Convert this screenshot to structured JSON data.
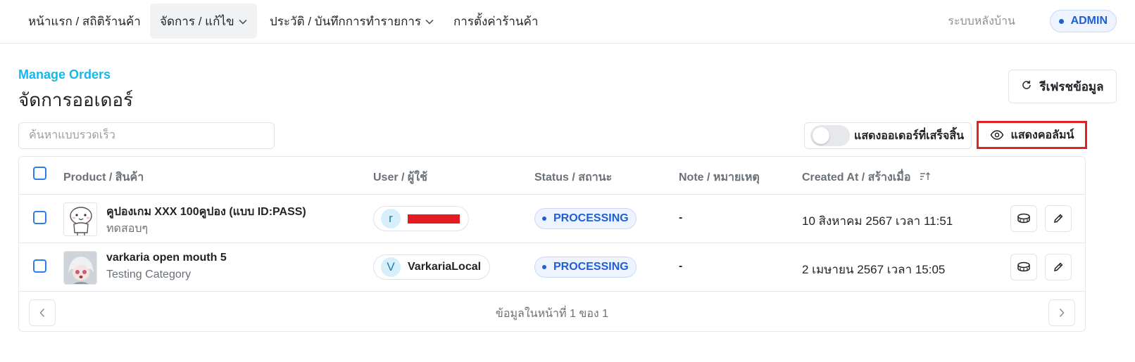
{
  "nav": {
    "items": [
      {
        "label": "หน้าแรก / สถิติร้านค้า"
      },
      {
        "label": "จัดการ / แก้ไข"
      },
      {
        "label": "ประวัติ / บันทึกการทำรายการ"
      },
      {
        "label": "การตั้งค่าร้านค้า"
      }
    ],
    "backoffice_label": "ระบบหลังบ้าน",
    "role_badge": "ADMIN"
  },
  "header": {
    "eyebrow": "Manage Orders",
    "title": "จัดการออเดอร์",
    "refresh_label": "รีเฟรชข้อมูล"
  },
  "toolbar": {
    "search_placeholder": "ค้นหาแบบรวดเร็ว",
    "toggle_label": "แสดงออเดอร์ที่เสร็จสิ้น",
    "toggle_on": false,
    "columns_label": "แสดงคอลัมน์"
  },
  "table": {
    "headers": {
      "product": "Product / สินค้า",
      "user": "User / ผู้ใช้",
      "status": "Status / สถานะ",
      "note": "Note / หมายเหตุ",
      "created": "Created At / สร้างเมื่อ"
    },
    "rows": [
      {
        "product_name": "คูปองเกม XXX 100คูปอง (แบบ ID:PASS)",
        "product_category": "ทดสอบๆ",
        "user_initial": "r",
        "user_name": "",
        "status": "PROCESSING",
        "note": "-",
        "created_at": "10 สิงหาคม 2567 เวลา 11:51"
      },
      {
        "product_name": "varkaria open mouth 5",
        "product_category": "Testing Category",
        "user_initial": "V",
        "user_name": "VarkariaLocal",
        "status": "PROCESSING",
        "note": "-",
        "created_at": "2 เมษายน 2567 เวลา 15:05"
      }
    ]
  },
  "pagination": {
    "text": "ข้อมูลในหน้าที่ 1 ของ 1"
  },
  "colors": {
    "accent": "#19b6e8",
    "status_blue": "#1f5fd6",
    "highlight_red": "#e02424"
  }
}
